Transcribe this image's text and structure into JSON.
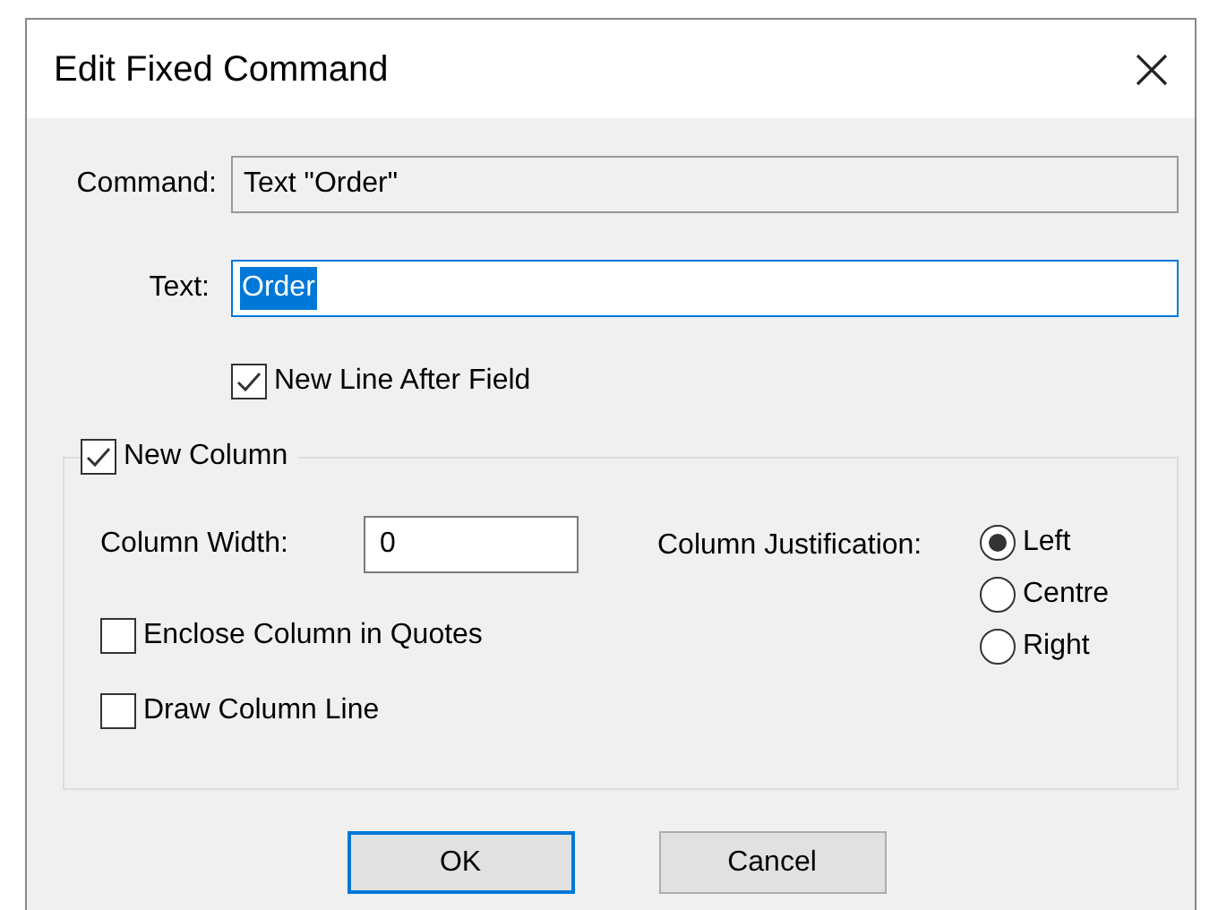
{
  "window": {
    "title": "Edit Fixed Command"
  },
  "command": {
    "label": "Command:",
    "value": "Text \"Order\"",
    "disabled": true
  },
  "text": {
    "label": "Text:",
    "value": "Order",
    "focused": true,
    "value_selected": true
  },
  "new_line_after_field": {
    "label": "New Line After Field",
    "checked": true
  },
  "new_column": {
    "label": "New Column",
    "checked": true,
    "column_width": {
      "label": "Column Width:",
      "value": "0"
    },
    "options": [
      {
        "label": "Enclose Column in Quotes",
        "checked": false
      },
      {
        "label": "Draw Column Line",
        "checked": false
      }
    ],
    "justification": {
      "label": "Column Justification:",
      "options": [
        {
          "label": "Left",
          "selected": true
        },
        {
          "label": "Centre",
          "selected": false
        },
        {
          "label": "Right",
          "selected": false
        }
      ]
    }
  },
  "buttons": [
    {
      "label": "OK",
      "default": true
    },
    {
      "label": "Cancel",
      "default": false
    }
  ]
}
